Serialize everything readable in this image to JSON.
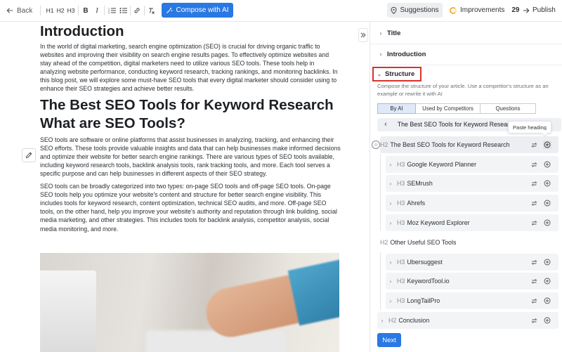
{
  "toolbar": {
    "back_label": "Back",
    "format_buttons": [
      "H1",
      "H2",
      "H3",
      "B",
      "I"
    ],
    "compose_label": "Compose with AI",
    "suggestions_label": "Suggestions",
    "improvements_label": "Improvements",
    "improvements_count": "29",
    "publish_label": "Publish"
  },
  "editor": {
    "heading_intro": "Introduction",
    "para_intro": "In the world of digital marketing, search engine optimization (SEO) is crucial for driving organic traffic to websites and improving their visibility on search engine results pages. To effectively optimize websites and stay ahead of the competition, digital marketers need to utilize various SEO tools. These tools help in analyzing website performance, conducting keyword research, tracking rankings, and monitoring backlinks. In this blog post, we will explore some must-have SEO tools that every digital marketer should consider using to enhance their SEO strategies and achieve better results.",
    "heading_best": "The Best SEO Tools for Keyword Research",
    "heading_what": "What are SEO Tools?",
    "para_what1": "SEO tools are software or online platforms that assist businesses in analyzing, tracking, and enhancing their SEO efforts. These tools provide valuable insights and data that can help businesses make informed decisions and optimize their website for better search engine rankings. There are various types of SEO tools available, including keyword research tools, backlink analysis tools, rank tracking tools, and more. Each tool serves a specific purpose and can help businesses in different aspects of their SEO strategy.",
    "para_what2": "SEO tools can be broadly categorized into two types: on-page SEO tools and off-page SEO tools. On-page SEO tools help you optimize your website's content and structure for better search engine visibility. This includes tools for keyword research, content optimization, technical SEO audits, and more. Off-page SEO tools, on the other hand, help you improve your website's authority and reputation through link building, social media marketing, and other strategies. This includes tools for backlink analysis, competitor analysis, social media monitoring, and more."
  },
  "panel": {
    "sections": {
      "title": "Title",
      "introduction": "Introduction",
      "structure": "Structure"
    },
    "structure_desc": "Compose the structure of your article. Use a competitor's structure as an example or rewrite it with AI",
    "tabs": [
      "By AI",
      "Used by Competitors",
      "Questions"
    ],
    "active_tab": "By AI",
    "carousel_title": "The Best SEO Tools for Keyword Research",
    "tooltip": "Paste heading",
    "outline": [
      {
        "level": "H2",
        "text": "The Best SEO Tools for Keyword Research"
      },
      {
        "level": "H3",
        "text": "Google Keyword Planner"
      },
      {
        "level": "H3",
        "text": "SEMrush"
      },
      {
        "level": "H3",
        "text": "Ahrefs"
      },
      {
        "level": "H3",
        "text": "Moz Keyword Explorer"
      },
      {
        "level": "H2",
        "text": "Other Useful SEO Tools"
      },
      {
        "level": "H3",
        "text": "Ubersuggest"
      },
      {
        "level": "H3",
        "text": "KeywordTool.io"
      },
      {
        "level": "H3",
        "text": "LongTailPro"
      },
      {
        "level": "H2",
        "text": "Conclusion"
      }
    ],
    "next_label": "Next"
  },
  "colors": {
    "accent": "#2a78e4",
    "highlight_border": "#d9322d",
    "improvements_ring": "#f3b234"
  },
  "icons": [
    "back-arrow-icon",
    "list-ordered-icon",
    "list-bullet-icon",
    "link-icon",
    "clear-format-icon",
    "magic-wand-icon",
    "pin-icon",
    "publish-arrow-icon",
    "collapse-icon",
    "chevron-right-icon",
    "chevron-down-icon",
    "chevron-left-icon",
    "swap-icon",
    "plus-circle-icon",
    "pencil-icon",
    "smile-icon"
  ]
}
